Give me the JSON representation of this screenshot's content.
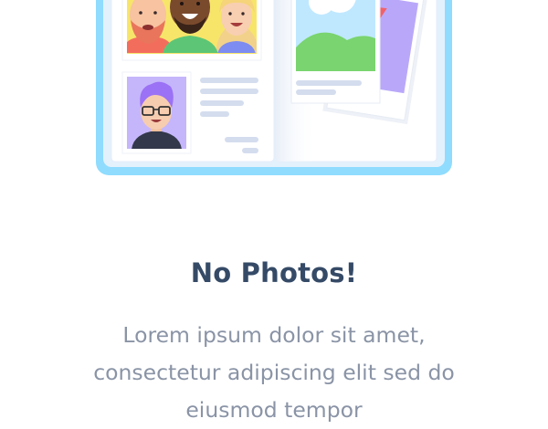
{
  "empty_state": {
    "title": "No Photos!",
    "description": "Lorem ipsum dolor sit amet, consectetur adipiscing elit sed do eiusmod tempor"
  },
  "colors": {
    "frame": "#8fdcff",
    "title": "#354a66",
    "text": "#8a94a6",
    "purple": "#b9a8f9",
    "green": "#7ad46f",
    "sky": "#bfe8ff"
  },
  "icons": [
    "photo-album-illustration",
    "group-portrait-icon",
    "avatar-portrait-icon",
    "landscape-photo-icon",
    "pennant-photo-icon"
  ]
}
